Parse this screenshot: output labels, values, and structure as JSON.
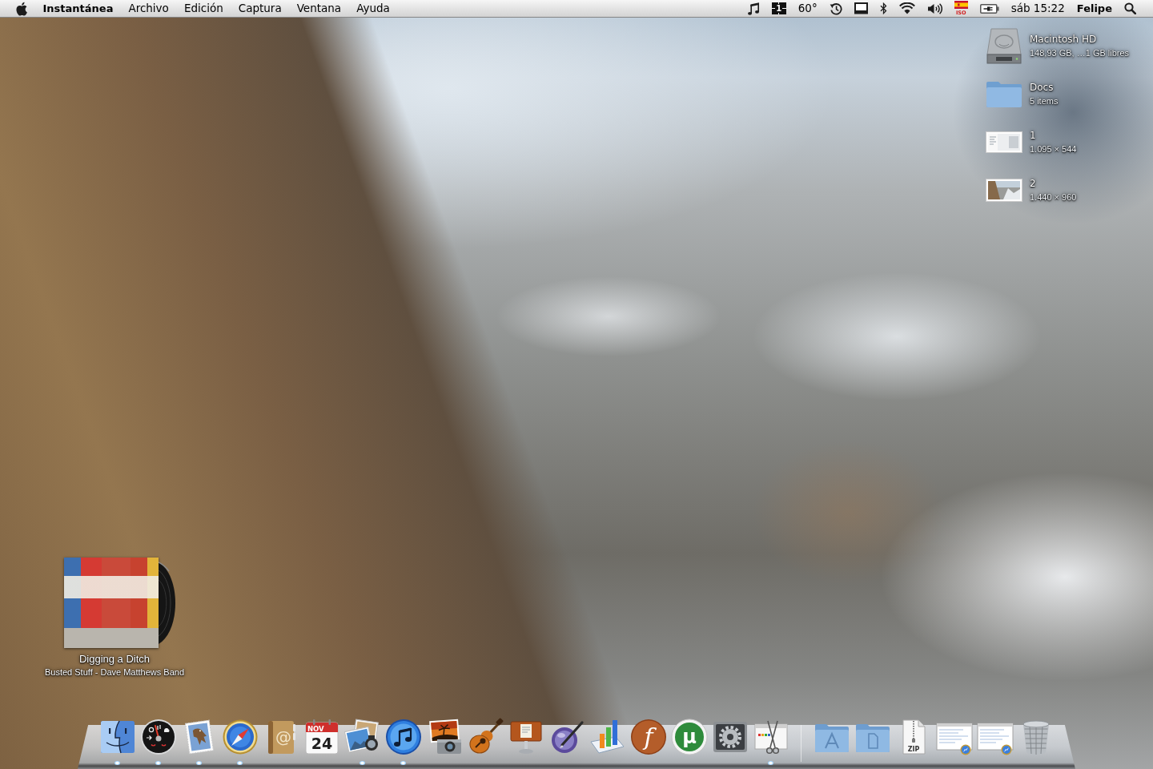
{
  "menu_bar": {
    "app_name": "Instantánea",
    "menus": [
      "Archivo",
      "Edición",
      "Captura",
      "Ventana",
      "Ayuda"
    ],
    "status_items": [
      {
        "kind": "music-note"
      },
      {
        "kind": "spaces",
        "label": "1"
      },
      {
        "kind": "temperature",
        "label": "60°"
      },
      {
        "kind": "time-machine"
      },
      {
        "kind": "display"
      },
      {
        "kind": "bluetooth"
      },
      {
        "kind": "wifi"
      },
      {
        "kind": "volume"
      },
      {
        "kind": "input-flag",
        "label": "ISO"
      },
      {
        "kind": "battery"
      }
    ],
    "clock": "sáb 15:22",
    "user": "Felipe"
  },
  "desktop_icons": [
    {
      "kind": "hard-drive",
      "name": "Macintosh HD",
      "info": "148,93 GB, …1 GB libres"
    },
    {
      "kind": "folder",
      "name": "Docs",
      "info": "5 items"
    },
    {
      "kind": "window-screenshot",
      "name": "1",
      "info": "1.095 × 544"
    },
    {
      "kind": "landscape-screenshot",
      "name": "2",
      "info": "1.440 × 960"
    }
  ],
  "now_playing": {
    "title": "Digging a Ditch",
    "subtitle": "Busted Stuff - Dave Matthews Band"
  },
  "dock": {
    "apps": [
      {
        "kind": "finder",
        "running": true
      },
      {
        "kind": "dashboard",
        "running": true
      },
      {
        "kind": "mail",
        "running": true
      },
      {
        "kind": "safari",
        "running": true
      },
      {
        "kind": "address-book",
        "glyph": "@",
        "running": false
      },
      {
        "kind": "calendar",
        "month": "NOV",
        "day": "24",
        "running": false
      },
      {
        "kind": "iphoto",
        "running": true
      },
      {
        "kind": "itunes",
        "running": true
      },
      {
        "kind": "image-capture",
        "running": false
      },
      {
        "kind": "garageband",
        "running": false
      },
      {
        "kind": "keynote",
        "running": false
      },
      {
        "kind": "script-editor",
        "running": false
      },
      {
        "kind": "numbers",
        "running": false
      },
      {
        "kind": "font-app",
        "glyph": "f",
        "running": false
      },
      {
        "kind": "utorrent",
        "glyph": "µ",
        "running": false
      },
      {
        "kind": "system-preferences",
        "running": false
      },
      {
        "kind": "grab",
        "running": true
      }
    ],
    "stacks": [
      {
        "kind": "applications-folder"
      },
      {
        "kind": "documents-folder"
      },
      {
        "kind": "zip-file",
        "label": "ZIP"
      },
      {
        "kind": "web-document"
      },
      {
        "kind": "web-document"
      },
      {
        "kind": "trash"
      }
    ]
  }
}
